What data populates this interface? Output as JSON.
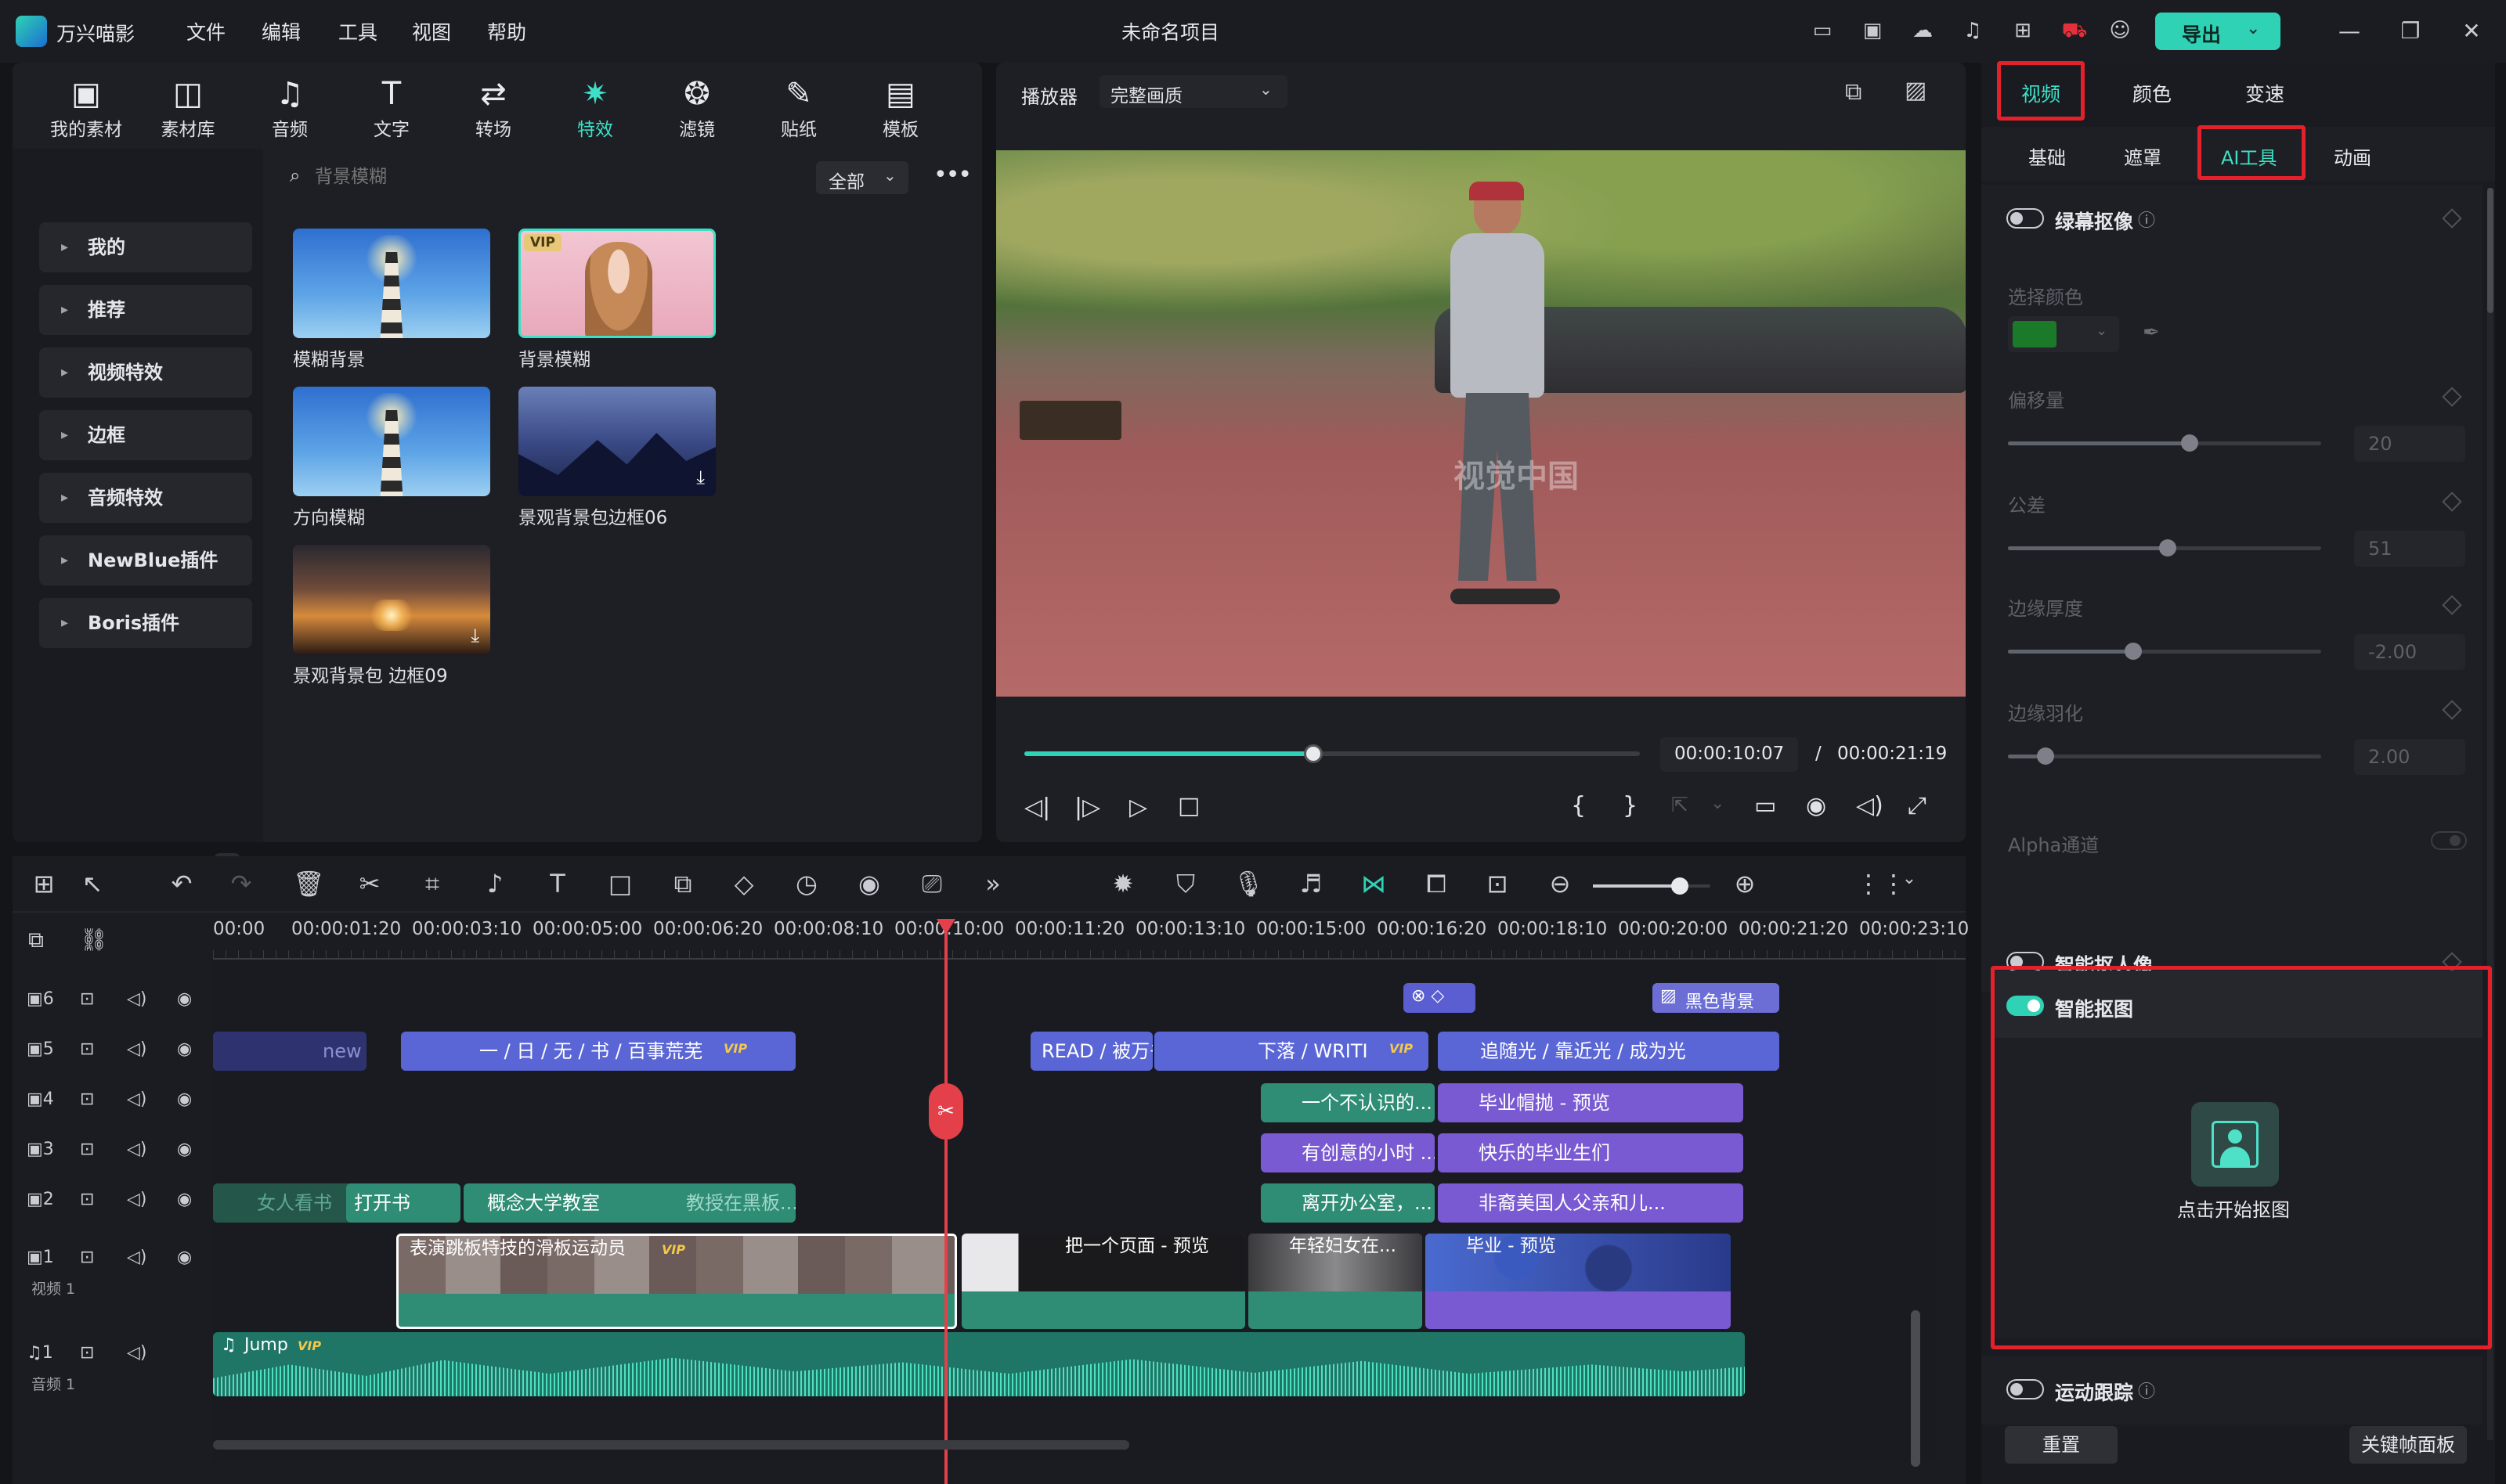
{
  "app": {
    "name": "万兴喵影",
    "project_title": "未命名项目",
    "export_label": "导出"
  },
  "menu": [
    "文件",
    "编辑",
    "工具",
    "视图",
    "帮助"
  ],
  "library_tabs": [
    {
      "label": "我的素材",
      "icon": "folder-image-icon"
    },
    {
      "label": "素材库",
      "icon": "media-library-icon"
    },
    {
      "label": "音频",
      "icon": "music-note-icon"
    },
    {
      "label": "文字",
      "icon": "text-icon"
    },
    {
      "label": "转场",
      "icon": "transition-icon"
    },
    {
      "label": "特效",
      "icon": "effects-sparkle-icon",
      "active": true
    },
    {
      "label": "滤镜",
      "icon": "filter-icon"
    },
    {
      "label": "贴纸",
      "icon": "sticker-icon"
    },
    {
      "label": "模板",
      "icon": "template-icon"
    }
  ],
  "categories": [
    "我的",
    "推荐",
    "视频特效",
    "边框",
    "音频特效",
    "NewBlue插件",
    "Boris插件"
  ],
  "search": {
    "placeholder": "背景模糊",
    "filter": "全部"
  },
  "effects": [
    {
      "label": "模糊背景"
    },
    {
      "label": "背景模糊",
      "vip": "VIP"
    },
    {
      "label": "方向模糊"
    },
    {
      "label": "景观背景包边框06"
    },
    {
      "label": "景观背景包 边框09"
    }
  ],
  "player": {
    "label": "播放器",
    "quality": "完整画质",
    "current_time": "00:00:10:07",
    "separator": "/",
    "total_time": "00:00:21:19",
    "progress": 0.47,
    "watermark": "视觉中国"
  },
  "props": {
    "top_tabs": [
      "视频",
      "颜色",
      "变速"
    ],
    "sub_tabs": [
      "基础",
      "遮罩",
      "AI工具",
      "动画"
    ],
    "chroma_key": "绿幕抠像",
    "select_color": "选择颜色",
    "swatch_color": "#1a7a2a",
    "offset": {
      "label": "偏移量",
      "value": "20",
      "level": 0.58
    },
    "tolerance": {
      "label": "公差",
      "value": "51",
      "level": 0.51
    },
    "edge_thickness": {
      "label": "边缘厚度",
      "value": "-2.00",
      "level": 0.4
    },
    "edge_feather": {
      "label": "边缘羽化",
      "value": "2.00",
      "level": 0.12
    },
    "alpha": "Alpha通道",
    "smart_portrait": "智能抠人像",
    "smart_cutout": "智能抠图",
    "start_cutout": "点击开始抠图",
    "motion_tracking": "运动跟踪",
    "reset": "重置",
    "keyframe_panel": "关键帧面板"
  },
  "timeline": {
    "ticks": [
      "00:00",
      "00:00:01:20",
      "00:00:03:10",
      "00:00:05:00",
      "00:00:06:20",
      "00:00:08:10",
      "00:00:10:00",
      "00:00:11:20",
      "00:00:13:10",
      "00:00:15:00",
      "00:00:16:20",
      "00:00:18:10",
      "00:00:20:00",
      "00:00:21:20",
      "00:00:23:10"
    ],
    "tracks": [
      {
        "num": "6"
      },
      {
        "num": "5"
      },
      {
        "num": "4"
      },
      {
        "num": "3"
      },
      {
        "num": "2"
      },
      {
        "num": "1",
        "name": "视频 1"
      }
    ],
    "audio_track": {
      "num": "1",
      "name": "音频 1"
    },
    "clips": {
      "black_bg": "黑色背景",
      "t5a": "new sem",
      "t5b": "一 / 日 / 无 / 书 / 百事荒芜",
      "t5c": "READ / 被万书",
      "t5d": "下落 / WRITI",
      "t5e": "追随光 / 靠近光 / 成为光",
      "t4a": "一个不认识的...",
      "t4b": "毕业帽抛 - 预览",
      "t3a": "有创意的小时 ...",
      "t3b": "快乐的毕业生们",
      "t2a": "女人看书",
      "t2b": "打开书",
      "t2c": "概念大学教室",
      "t2d": "教授在黑板...",
      "t2e": "离开办公室，...",
      "t2f": "非裔美国人父亲和儿...",
      "v1a": "表演跳板特技的滑板运动员",
      "v1b": "把一个页面 - 预览",
      "v1c": "年轻妇女在...",
      "v1d": "毕业 - 预览",
      "audio": "Jump",
      "vip": "VIP"
    }
  }
}
